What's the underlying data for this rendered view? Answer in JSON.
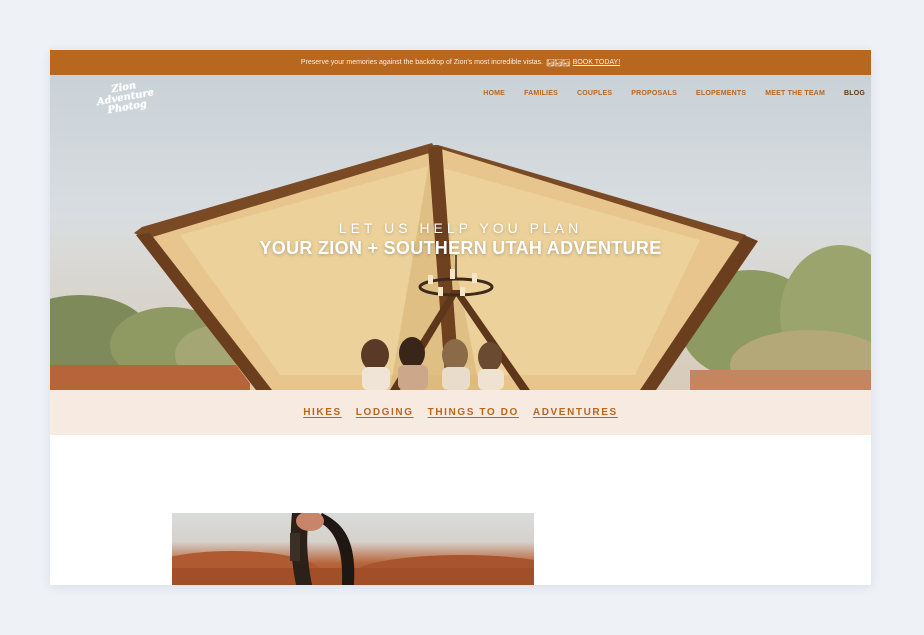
{
  "announcement": {
    "text": "Preserve your memories against the backdrop of Zion's most incredible vistas.",
    "emoji": "🏜🏜🏜",
    "link": "BOOK TODAY!"
  },
  "logo": {
    "lines": [
      "Zion",
      "Adventure",
      "Photog"
    ]
  },
  "nav": {
    "items": [
      "HOME",
      "FAMILIES",
      "COUPLES",
      "PROPOSALS",
      "ELOPEMENTS",
      "MEET THE TEAM",
      "BLOG"
    ]
  },
  "hero": {
    "subtitle": "LET US HELP YOU PLAN",
    "title": "YOUR ZION + SOUTHERN UTAH ADVENTURE"
  },
  "categories": [
    "HIKES",
    "LODGING",
    "THINGS TO DO",
    "ADVENTURES"
  ],
  "colors": {
    "accent": "#b8671f",
    "nav_dark": "#5b3a1c",
    "category_bar": "#f7ebe1"
  }
}
